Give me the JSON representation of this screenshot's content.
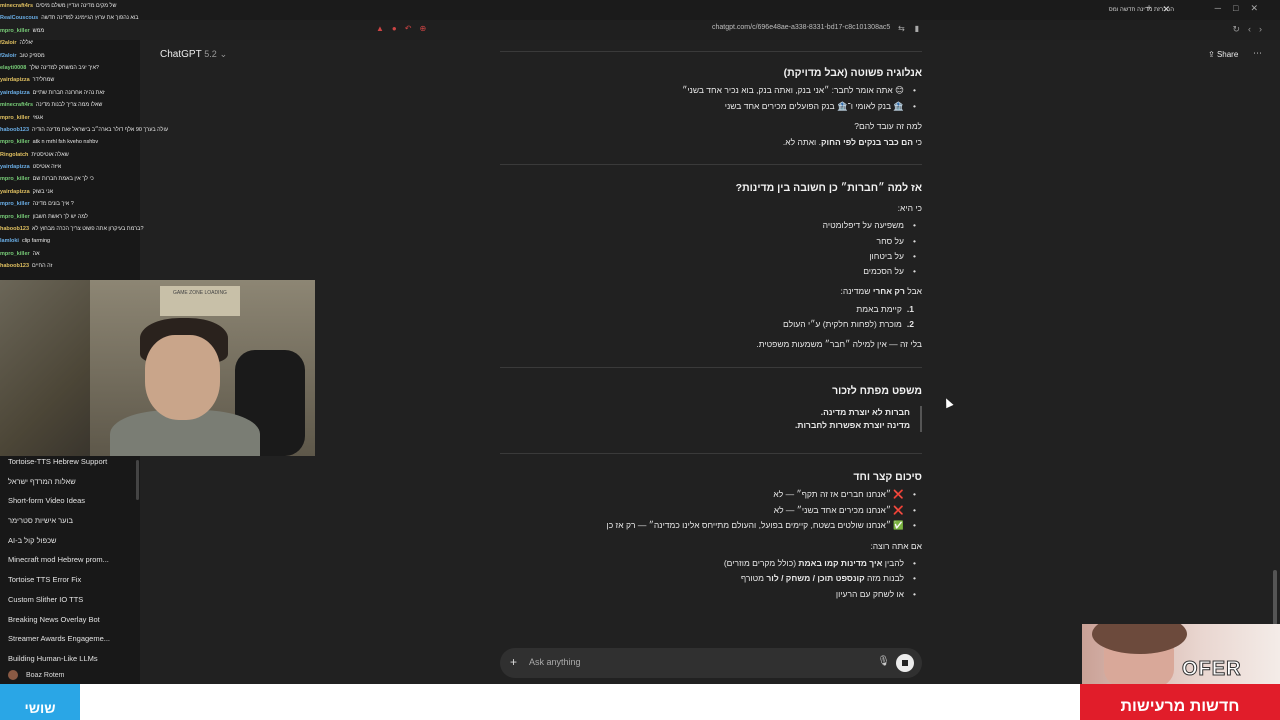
{
  "browser": {
    "tab_title": "ההכרזת מדינה חדשה ומס",
    "url": "chatgpt.com/c/696e48ae-a338-8331-bd17-c8c101308ac5"
  },
  "header": {
    "model_name": "ChatGPT",
    "model_version": "5.2",
    "share_label": "Share"
  },
  "sidebar": {
    "chats": [
      "Tortoise-TTS Hebrew Support",
      "שאלות המרדף ישראל",
      "Short-form Video Ideas",
      "בוער אישיות סטרימר",
      "AI-שכפול קול ב",
      "Minecraft mod Hebrew prom...",
      "Tortoise TTS Error Fix",
      "Custom Slither IO TTS",
      "Breaking News Overlay Bot",
      "Streamer Awards Engageme...",
      "Building Human-Like LLMs"
    ],
    "user_name": "Boaz Rotem"
  },
  "stream_chat": [
    {
      "name": "minecraft4rs",
      "text": "של מקים מדינה ועדיין משלם מיסים"
    },
    {
      "name": "RealCouscous",
      "text": "בוא נהפוך את ערוץ הגיימינג למדינה חדשה"
    },
    {
      "name": "mpro_killer",
      "text": "ממש"
    },
    {
      "name": "f2aloir",
      "text": "יאללה"
    },
    {
      "name": "f2aloir",
      "text": "מספיק טוב"
    },
    {
      "name": "elayti0008",
      "text": "איך יגיב המשחק למדינה שלך?"
    },
    {
      "name": "yairdapizza",
      "text": "שמחלידר"
    },
    {
      "name": "yairdapizza",
      "text": "זאת נהיה אחרונה חברות שתיים"
    },
    {
      "name": "minecraft4rs",
      "text": "שאלו ממה צריך לבנות מדינה"
    },
    {
      "name": "mpro_killer",
      "text": "אגוזי"
    },
    {
      "name": "haboob123",
      "text": "עולה בערך 90 אלף דולר בארה״ב בישראל זאת מדינה הודיה"
    },
    {
      "name": "mpro_killer",
      "text": "atk n mrhl fsh kveho nshbv"
    },
    {
      "name": "Ringolatch",
      "text": "שאלה אוטיסטית"
    },
    {
      "name": "yairdapizza",
      "text": "איזה אוטיסט"
    },
    {
      "name": "mpro_killer",
      "text": "כי לך אין באמת חברות שם"
    },
    {
      "name": "yairdapizza",
      "text": "אני בשוק"
    },
    {
      "name": "mpro_killer",
      "text": "איך בונים מדינה ?"
    },
    {
      "name": "mpro_killer",
      "text": "למה יש לך ראשת חשבון"
    },
    {
      "name": "haboob123",
      "text": "ברמת בעיקרון אתה פשוט צריך הכרה מבחוץ לא?"
    },
    {
      "name": "lamloki",
      "text": "clip farming"
    },
    {
      "name": "mpro_killer",
      "text": "אה"
    },
    {
      "name": "haboob123",
      "text": "זה החיים"
    }
  ],
  "conversation": {
    "section1": {
      "heading": "אנלוגיה פשוטה (אבל מדויקת)",
      "bullets": [
        "😊 אתה אומר לחבר: ״אני בנק, ואתה בנק, בוא נכיר אחד בשני״",
        "🏦 בנק לאומי ו־🏦 בנק הפועלים מכירים אחד בשני"
      ],
      "q": "למה זה עובד להם?",
      "a_prefix": "כי ",
      "a_bold": "הם כבר בנקים לפי החוק",
      "a_suffix": ". ואתה לא."
    },
    "section2": {
      "heading": "אז למה ״חברות״ כן חשובה בין מדינות?",
      "intro": "כי היא:",
      "bullets": [
        "משפיעה על דיפלומטיה",
        "על סחר",
        "על ביטחון",
        "על הסכמים"
      ],
      "but_prefix": "אבל ",
      "but_bold": "רק אחרי",
      "but_suffix": " שמדינה:",
      "numbered": [
        {
          "n": "1.",
          "text": "קיימת באמת"
        },
        {
          "n": "2.",
          "text": "מוכרת (לפחות חלקית) ע״י העולם"
        }
      ],
      "closing": "בלי זה — אין למילה ״חבר״ משמעות משפטית."
    },
    "section3": {
      "heading": "משפט מפתח לזכור",
      "quote_line1": "חברות לא יוצרת מדינה.",
      "quote_line2": "מדינה יוצרת אפשרות לחברות."
    },
    "section4": {
      "heading": "סיכום קצר וחד",
      "items": [
        {
          "icon": "❌",
          "icon_name": "cross-icon",
          "text": "״אנחנו חברים אז זה תקף״ — לא"
        },
        {
          "icon": "❌",
          "icon_name": "cross-icon",
          "text": "״אנחנו מכירים אחד בשני״ — לא"
        },
        {
          "icon": "✅",
          "icon_name": "check-icon",
          "text": "״אנחנו שולטים בשטח, קיימים בפועל, והעולם מתייחס אלינו כמדינה״ — רק אז כן"
        }
      ],
      "offer_intro": "אם אתה רוצה:",
      "offers": [
        {
          "prefix": "להבין ",
          "bold": "איך מדינות קמו באמת",
          "suffix": " (כולל מקרים מוזרים)"
        },
        {
          "prefix": "לבנות מזה ",
          "bold": "קונספט תוכן / משחק / לור",
          "suffix": " מטורף"
        },
        {
          "prefix": "או לשחק עם הרעיון",
          "bold": "",
          "suffix": ""
        }
      ]
    }
  },
  "composer": {
    "placeholder": "Ask anything"
  },
  "overlay": {
    "ticker_left": "שושי",
    "ticker_right": "חדשות מרעישות",
    "brand": "OFER",
    "webcam_sign": "GAME ZONE LOADING"
  },
  "colors": {
    "background": "#212121",
    "sidebar": "#181818",
    "ticker_red": "#e11d2a",
    "ticker_blue": "#2aa6e6"
  }
}
